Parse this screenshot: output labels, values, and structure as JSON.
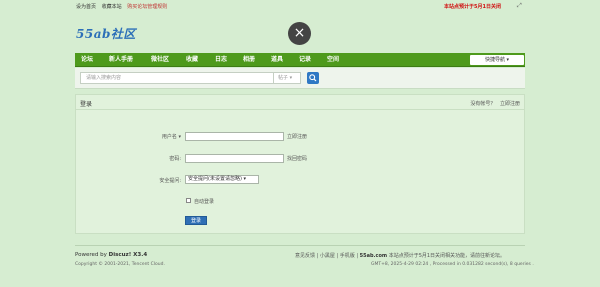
{
  "topbar": {
    "links": [
      "设为首页",
      "收藏本站",
      "购买论坛管理规则"
    ],
    "notice": "本站点预计于5月1日关闭",
    "expand_icon": "expand-icon"
  },
  "logo": {
    "text": "55ab社区"
  },
  "close_icon": "×",
  "nav": {
    "items": [
      "论坛",
      "新人手册",
      "微社区",
      "收藏",
      "日志",
      "相册",
      "道具",
      "记录",
      "空间"
    ],
    "quick_nav": "快捷导航 ▾"
  },
  "search": {
    "placeholder": "请输入搜索内容",
    "type": "帖子 ▾"
  },
  "login": {
    "title": "登录",
    "links": [
      "没有帐号？",
      "立即注册"
    ],
    "username_label": "用户名 ▾",
    "username_hint": "立即注册",
    "password_label": "密码:",
    "password_hint": "找回密码",
    "question_label": "安全提问:",
    "question_value": "安全提问(未设置请忽略) ▾",
    "autologin_label": "自动登录",
    "submit_label": "登录"
  },
  "footer": {
    "powered": "Powered by",
    "product": "Discuz! X3.4",
    "copyright": "Copyright © 2001-2021, Tencent Cloud.",
    "links": [
      "意见反馈",
      "小黑屋",
      "手机版"
    ],
    "site": "55ab.com",
    "site_notice": "本站点预计于5月1日关闭相关功能，请前往新论坛。",
    "stats": "GMT+8, 2025-4-29 02:24 , Processed in 0.031282 second(s), 8 queries ."
  }
}
